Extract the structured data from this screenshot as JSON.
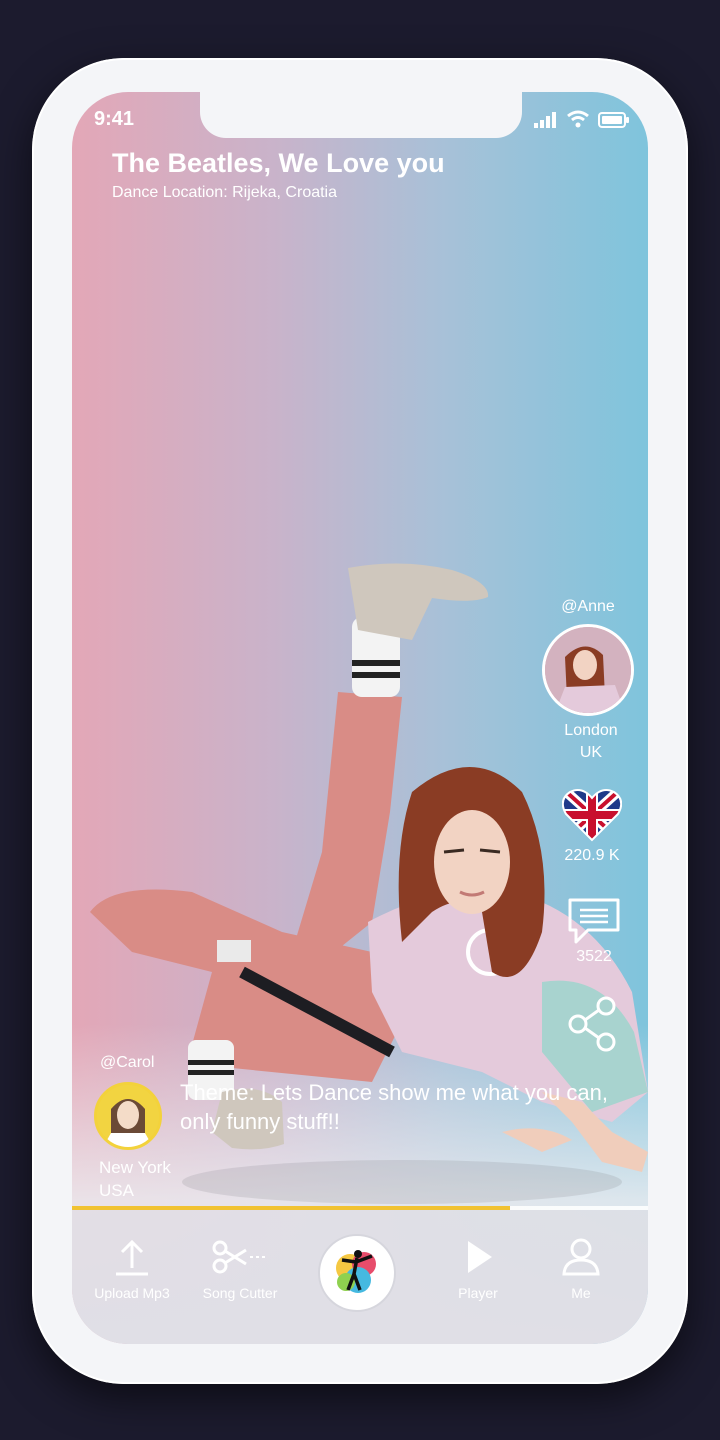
{
  "status_bar": {
    "time": "9:41"
  },
  "video": {
    "title": "The Beatles, We Love you",
    "location": "Dance Location: Rijeka, Croatia",
    "theme": "Theme: Lets Dance show me what you can, only funny stuff!!",
    "progress": 0.76
  },
  "creator": {
    "handle": "@Anne",
    "city": "London",
    "country": "UK"
  },
  "stats": {
    "likes": "220.9 K",
    "comments": "3522"
  },
  "commenter": {
    "handle": "@Carol",
    "city": "New York",
    "country": "USA"
  },
  "nav": {
    "upload_label": "Upload Mp3",
    "cutter_label": "Song Cutter",
    "player_label": "Player",
    "me_label": "Me"
  },
  "icons": [
    "upload-icon",
    "scissors-icon",
    "dance-logo-icon",
    "play-icon",
    "user-icon",
    "heart-flag-icon",
    "comment-icon",
    "share-icon"
  ],
  "colors": {
    "progress": "#f1c232",
    "device": "#f4f5f8",
    "background": "#1c1b2e"
  }
}
